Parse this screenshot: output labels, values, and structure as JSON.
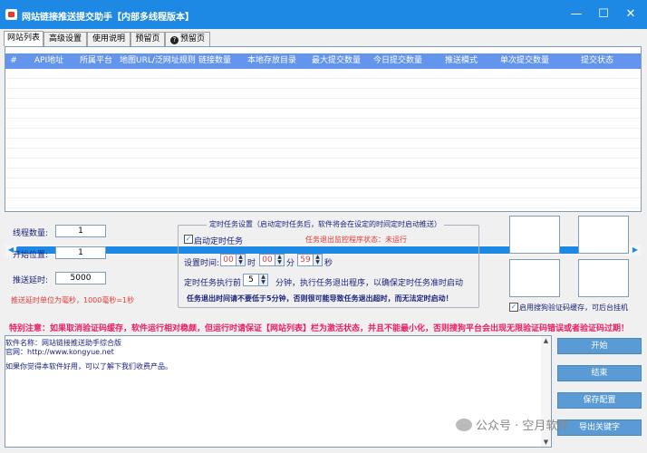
{
  "window": {
    "title": "网站链接推送提交助手【内部多线程版本】",
    "minimize": "—",
    "maximize": "☐",
    "close": "✕"
  },
  "tabs": [
    {
      "label": "网站列表",
      "active": true
    },
    {
      "label": "高级设置"
    },
    {
      "label": "使用说明"
    },
    {
      "label": "预留页"
    },
    {
      "label": "预留页",
      "icon": "help-icon"
    }
  ],
  "table": {
    "columns": [
      "#",
      "API地址",
      "所属平台",
      "地图URL/泛网址规则",
      "链接数量",
      "本地存放目录",
      "最大提交数量",
      "今日提交数量",
      "推送模式",
      "单次提交数量",
      "提交状态"
    ],
    "rows": []
  },
  "settings": {
    "thread_label": "线程数量:",
    "thread_value": "1",
    "start_label": "开始位置:",
    "start_value": "1",
    "delay_label": "推送延时:",
    "delay_value": "5000",
    "delay_note": "推送延时单位为毫秒，1000毫秒=1秒"
  },
  "timer": {
    "legend": "定时任务设置（启动定时任务后，软件将会在设定的时间定时启动推送）",
    "enable_label": "启动定时任务",
    "enable_checked": true,
    "monitor_status": "任务退出监控程序状态：未运行",
    "time_label": "设置时间:",
    "hour": "00",
    "hour_unit": "时",
    "minute": "00",
    "minute_unit": "分",
    "second": "59",
    "second_unit": "秒",
    "before_label": "定时任务执行前",
    "before_value": "5",
    "before_desc": "分钟，执行任务退出程序，以确保定时任务准时启动",
    "exit_note": "任务退出时间请不要低于5分钟，否则很可能导致任务退出超时，而无法定时启动！"
  },
  "captcha": {
    "label": "启用搜狗验证码缓存，可后台挂机",
    "checked": true
  },
  "warning": "特别注意：如果取消验证码缓存，软件运行相对稳颇，但运行时请保证【网站列表】栏为激活状态，并且不能最小化，否则搜狗平台会出现无限验证码错误或者验证码过期！",
  "log": {
    "lines": [
      "软件名称：网站链接推送助手综合版",
      "官网：http://www.kongyue.net",
      "如果你觉得本软件好用，可以了解下我们收费产品。"
    ]
  },
  "buttons": {
    "start": "开始",
    "stop": "结束",
    "save": "保存配置",
    "export": "导出关键字"
  },
  "watermark": "公众号 · 空月软件",
  "colors": {
    "titlebar": "#1e88e5",
    "header": "#6495ed",
    "button": "#5b9bd5",
    "warning": "#e91e63",
    "note": "#e53935"
  }
}
